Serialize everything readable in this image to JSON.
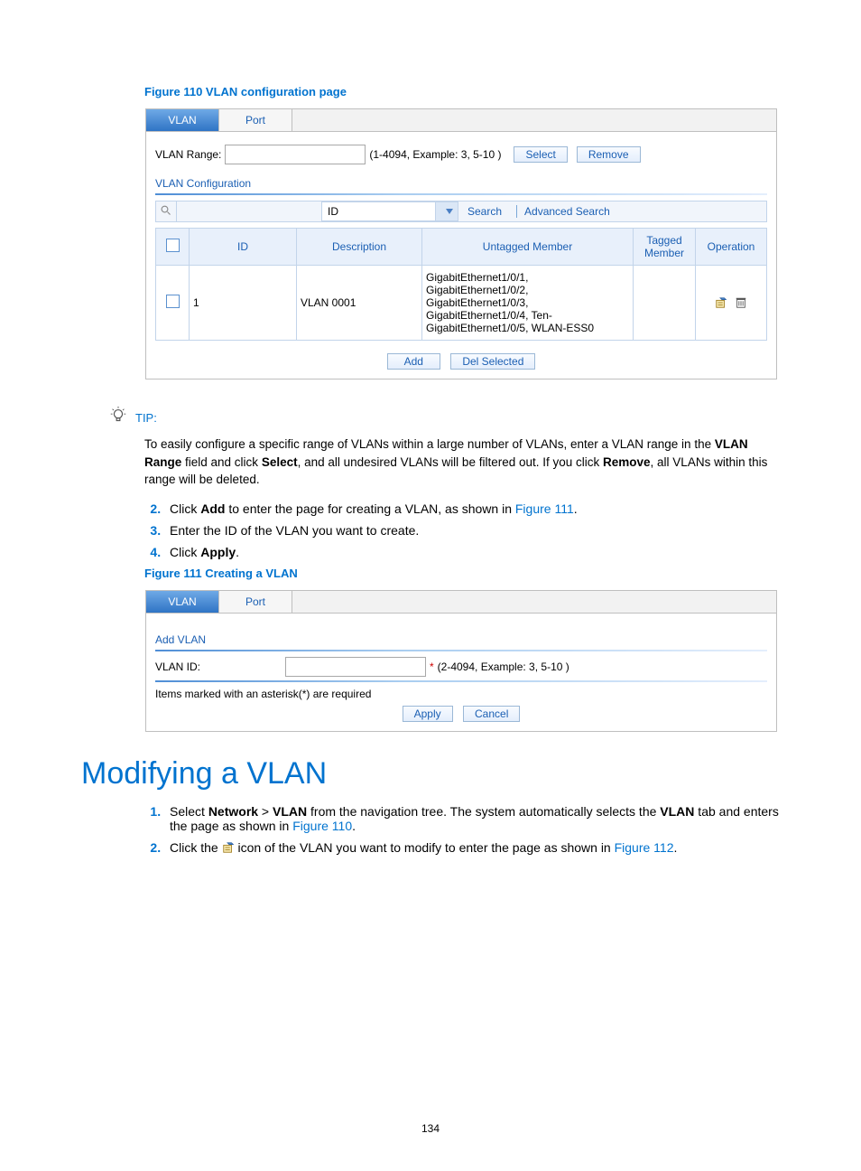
{
  "fig110": {
    "caption": "Figure 110 VLAN configuration page",
    "tabs": {
      "vlan": "VLAN",
      "port": "Port"
    },
    "vlanRangeLabel": "VLAN Range:",
    "vlanRangeHint": "(1-4094, Example: 3, 5-10 )",
    "selectBtn": "Select",
    "removeBtn": "Remove",
    "confTitle": "VLAN Configuration",
    "idDropdown": "ID",
    "searchBtn": "Search",
    "advSearch": "Advanced Search",
    "cols": {
      "id": "ID",
      "desc": "Description",
      "untag": "Untagged Member",
      "tag": "Tagged Member",
      "op": "Operation"
    },
    "row": {
      "id": "1",
      "desc": "VLAN 0001",
      "untag": "GigabitEthernet1/0/1, GigabitEthernet1/0/2, GigabitEthernet1/0/3, GigabitEthernet1/0/4, Ten-GigabitEthernet1/0/5, WLAN-ESS0",
      "tag": ""
    },
    "addBtn": "Add",
    "delSelBtn": "Del Selected"
  },
  "tip": {
    "label": "TIP:",
    "body_a": "To easily configure a specific range of VLANs within a large number of VLANs, enter a VLAN range in the ",
    "body_b": "VLAN Range",
    "body_c": " field and click ",
    "body_d": "Select",
    "body_e": ", and all undesired VLANs will be filtered out. If you click ",
    "body_f": "Remove",
    "body_g": ", all VLANs within this range will be deleted."
  },
  "stepsA": {
    "s2a": "Click ",
    "s2b": "Add",
    "s2c": " to enter the page for creating a VLAN, as shown in ",
    "s2link": "Figure 111",
    "s2d": ".",
    "s3": "Enter the ID of the VLAN you want to create.",
    "s4a": "Click ",
    "s4b": "Apply",
    "s4c": "."
  },
  "fig111": {
    "caption": "Figure 111 Creating a VLAN",
    "tabs": {
      "vlan": "VLAN",
      "port": "Port"
    },
    "addTitle": "Add VLAN",
    "idLabel": "VLAN ID:",
    "idHint": "(2-4094, Example: 3, 5-10 )",
    "reqNote": "Items marked with an asterisk(*) are required",
    "applyBtn": "Apply",
    "cancelBtn": "Cancel"
  },
  "h1": "Modifying a VLAN",
  "stepsB": {
    "s1a": "Select ",
    "s1b": "Network",
    "s1c": " > ",
    "s1d": "VLAN",
    "s1e": " from the navigation tree. The system automatically selects the ",
    "s1f": "VLAN",
    "s1g": " tab and enters the page as shown in ",
    "s1link": "Figure 110",
    "s1h": ".",
    "s2a": "Click the ",
    "s2b": " icon of the VLAN you want to modify to enter the page as shown in ",
    "s2link": "Figure 112",
    "s2c": "."
  },
  "pageNumber": "134"
}
